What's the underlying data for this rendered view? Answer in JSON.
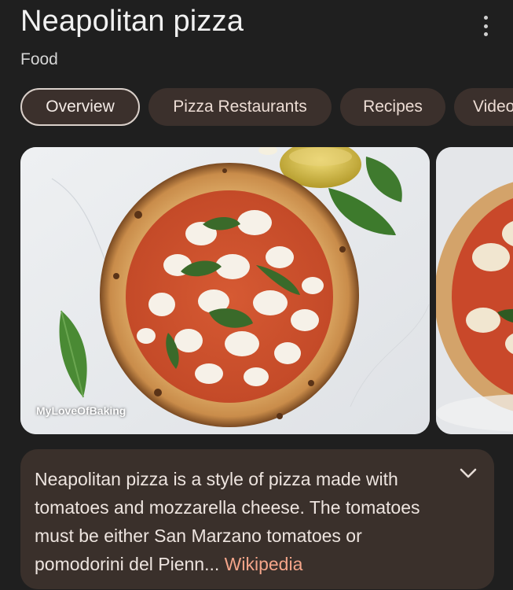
{
  "header": {
    "title": "Neapolitan pizza",
    "subtitle": "Food",
    "more_icon": "more-vert-icon"
  },
  "chips": [
    {
      "label": "Overview",
      "active": true
    },
    {
      "label": "Pizza Restaurants",
      "active": false
    },
    {
      "label": "Recipes",
      "active": false
    },
    {
      "label": "Videos",
      "active": false
    }
  ],
  "media": {
    "main_image": {
      "alt": "Neapolitan pizza",
      "credit": "MyLoveOfBaking"
    },
    "second_image": {
      "alt": "Neapolitan pizza"
    }
  },
  "description": {
    "text": "Neapolitan pizza is a style of pizza made with tomatoes and mozzarella cheese. The tomatoes must be either San Marzano tomatoes or pomodorini del Pienn... ",
    "source_link": "Wikipedia",
    "expand_icon": "chevron-down-icon"
  },
  "colors": {
    "background": "#1f1f1f",
    "chip_background": "#3b302c",
    "card_background": "#3a302b",
    "link": "#f4a58a"
  }
}
